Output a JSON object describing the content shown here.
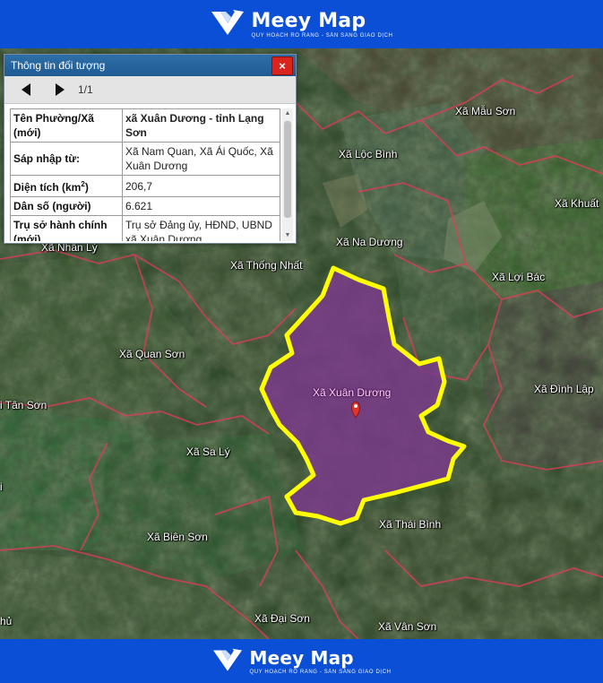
{
  "brand": {
    "name": "Meey Map",
    "tagline": "QUY HOẠCH RÕ RÀNG - SẴN SÀNG GIAO DỊCH",
    "color": "#0a4fd6"
  },
  "panel": {
    "title": "Thông tin đối tượng",
    "close": "×",
    "pager": "1/1",
    "rows": [
      {
        "key": "Tên Phường/Xã (mới)",
        "value": "xã Xuân Dương - tỉnh Lạng Sơn",
        "bold": true
      },
      {
        "key": "Sáp nhập từ:",
        "value": "Xã Nam Quan, Xã Ái Quốc, Xã Xuân Dương",
        "bold": false
      },
      {
        "key_prefix": "Diện tích (km",
        "key_sup": "2",
        "key_suffix": ")",
        "value": "206,7",
        "bold": false
      },
      {
        "key": "Dân số (người)",
        "value": "6.621",
        "bold": false
      },
      {
        "key": "Trụ sở hành chính (mới)",
        "value": "Trụ sở Đảng ủy, HĐND, UBND xã Xuân Dương",
        "bold": false
      }
    ]
  },
  "map": {
    "highlight_color": "#ffff00",
    "fill_color": "#7a3a8a",
    "selected": "Xã Xuân Dương",
    "places": [
      {
        "id": "mau-son",
        "label": "Xã Mẫu Sơn"
      },
      {
        "id": "loc-binh",
        "label": "Xã Lộc Bình"
      },
      {
        "id": "khuat-xa",
        "label": "Xã Khuất"
      },
      {
        "id": "na-duong",
        "label": "Xã Na Dương"
      },
      {
        "id": "nhan-ly",
        "label": "Xã Nhân Lý"
      },
      {
        "id": "thong-nhat",
        "label": "Xã Thống Nhất"
      },
      {
        "id": "loi-bac",
        "label": "Xã Lợi Bác"
      },
      {
        "id": "quan-son",
        "label": "Xã Quan Sơn"
      },
      {
        "id": "tan-son",
        "label": "i Tân Sơn"
      },
      {
        "id": "dinh-lap",
        "label": "Xã Đình Lập"
      },
      {
        "id": "sa-ly",
        "label": "Xã Sa Lý"
      },
      {
        "id": "thai-binh",
        "label": "Xã Thái Bình"
      },
      {
        "id": "bien-son",
        "label": "Xã Biên Sơn"
      },
      {
        "id": "dai-son",
        "label": "Xã Đại Sơn"
      },
      {
        "id": "van-son",
        "label": "Xã Vân Sơn"
      },
      {
        "id": "hu",
        "label": "hủ"
      },
      {
        "id": "edge-i",
        "label": "i"
      }
    ]
  }
}
